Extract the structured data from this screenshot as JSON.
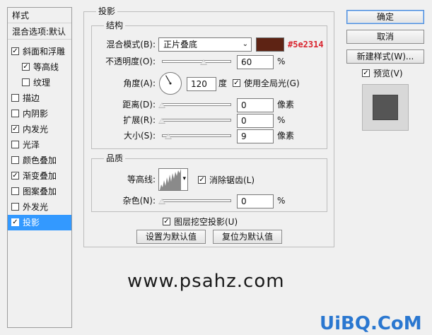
{
  "sidebar": {
    "header": "样式",
    "blend_options": "混合选项:默认",
    "items": [
      {
        "label": "斜面和浮雕",
        "checked": true
      },
      {
        "label": "等高线",
        "checked": true
      },
      {
        "label": "纹理",
        "checked": false
      },
      {
        "label": "描边",
        "checked": false
      },
      {
        "label": "内阴影",
        "checked": false
      },
      {
        "label": "内发光",
        "checked": true
      },
      {
        "label": "光泽",
        "checked": false
      },
      {
        "label": "颜色叠加",
        "checked": false
      },
      {
        "label": "渐变叠加",
        "checked": true
      },
      {
        "label": "图案叠加",
        "checked": false
      },
      {
        "label": "外发光",
        "checked": false
      },
      {
        "label": "投影",
        "checked": true
      }
    ]
  },
  "drop_shadow": {
    "title": "投影",
    "structure": {
      "title": "结构",
      "blend_mode_label": "混合模式(B):",
      "blend_mode_value": "正片叠底",
      "color": "#5e2314",
      "color_annotation": "#5e2314",
      "opacity_label": "不透明度(O):",
      "opacity_value": "60",
      "opacity_unit": "%",
      "opacity_fraction": 0.6,
      "angle_label": "角度(A):",
      "angle_value": "120",
      "angle_unit": "度",
      "global_light_label": "使用全局光(G)",
      "global_light_checked": true,
      "distance_label": "距离(D):",
      "distance_value": "0",
      "distance_unit": "像素",
      "spread_label": "扩展(R):",
      "spread_value": "0",
      "spread_unit": "%",
      "size_label": "大小(S):",
      "size_value": "9",
      "size_unit": "像素"
    },
    "quality": {
      "title": "品质",
      "contour_label": "等高线:",
      "anti_alias_label": "消除锯齿(L)",
      "anti_alias_checked": true,
      "noise_label": "杂色(N):",
      "noise_value": "0",
      "noise_unit": "%"
    },
    "knockout_label": "图层挖空投影(U)",
    "knockout_checked": true,
    "make_default_label": "设置为默认值",
    "reset_default_label": "复位为默认值"
  },
  "buttons": {
    "ok": "确定",
    "cancel": "取消",
    "new_style": "新建样式(W)...",
    "preview_label": "预览(V)",
    "preview_checked": true
  },
  "watermark": {
    "text": "www.psahz.com",
    "logo": "UiBQ.CoM"
  }
}
